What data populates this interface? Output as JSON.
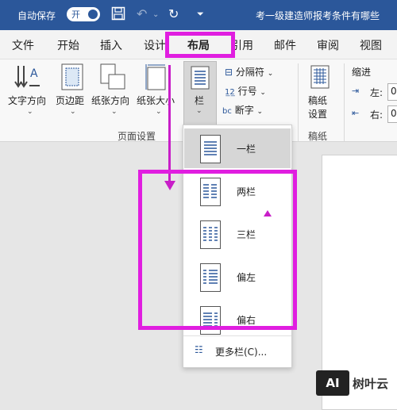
{
  "titlebar": {
    "autosave_label": "自动保存",
    "autosave_state": "开",
    "doc_title": "考一级建造师报考条件有哪些"
  },
  "tabs": [
    "文件",
    "开始",
    "插入",
    "设计",
    "布局",
    "引用",
    "邮件",
    "审阅",
    "视图"
  ],
  "ribbon": {
    "text_direction": "文字方向",
    "margins": "页边距",
    "orientation": "纸张方向",
    "size": "纸张大小",
    "columns": "栏",
    "breaks": "分隔符",
    "line_numbers": "行号",
    "hyphenation": "断字",
    "manuscript_line1": "稿纸",
    "manuscript_line2": "设置",
    "indent": "缩进",
    "left_label": "左:",
    "right_label": "右:",
    "left_value": "0",
    "right_value": "0",
    "group_page_setup": "页面设置",
    "group_manuscript": "稿纸"
  },
  "columns_menu": {
    "items": [
      "一栏",
      "两栏",
      "三栏",
      "偏左",
      "偏右"
    ],
    "more": "更多栏(C)..."
  },
  "watermark": {
    "logo": "AI",
    "text": "树叶云"
  },
  "colors": {
    "title_bar": "#2b579a",
    "highlight": "#e01ee0"
  }
}
